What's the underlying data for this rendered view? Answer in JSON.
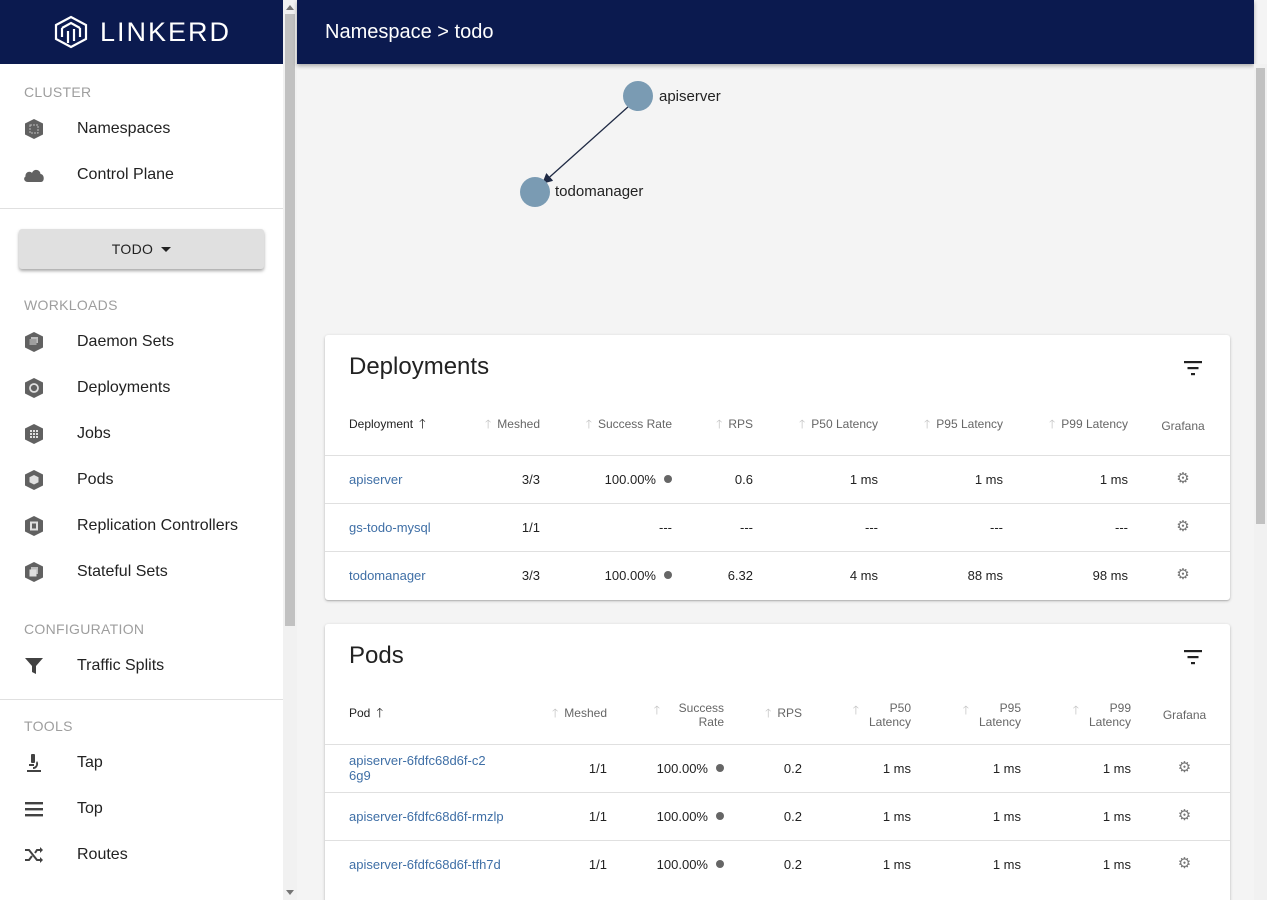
{
  "app": {
    "brand": "LINKERD"
  },
  "header": {
    "title": "Namespace > todo"
  },
  "sidebar": {
    "cluster_title": "CLUSTER",
    "cluster_items": [
      {
        "label": "Namespaces",
        "icon": "namespace-icon"
      },
      {
        "label": "Control Plane",
        "icon": "cloud-icon"
      }
    ],
    "namespace_select": "TODO",
    "workloads_title": "WORKLOADS",
    "workload_items": [
      {
        "label": "Daemon Sets",
        "icon": "daemonset-icon"
      },
      {
        "label": "Deployments",
        "icon": "deployment-icon"
      },
      {
        "label": "Jobs",
        "icon": "job-icon"
      },
      {
        "label": "Pods",
        "icon": "pod-icon"
      },
      {
        "label": "Replication Controllers",
        "icon": "replication-controller-icon"
      },
      {
        "label": "Stateful Sets",
        "icon": "statefulset-icon"
      }
    ],
    "configuration_title": "CONFIGURATION",
    "configuration_items": [
      {
        "label": "Traffic Splits",
        "icon": "filter-funnel-icon"
      }
    ],
    "tools_title": "TOOLS",
    "tools_items": [
      {
        "label": "Tap",
        "icon": "microscope-icon"
      },
      {
        "label": "Top",
        "icon": "list-icon"
      },
      {
        "label": "Routes",
        "icon": "shuffle-icon"
      }
    ]
  },
  "graph": {
    "nodes": [
      {
        "label": "apiserver"
      },
      {
        "label": "todomanager"
      }
    ],
    "node_color": "#7a9bb3"
  },
  "deployments": {
    "title": "Deployments",
    "columns": [
      "Deployment",
      "Meshed",
      "Success Rate",
      "RPS",
      "P50 Latency",
      "P95 Latency",
      "P99 Latency",
      "Grafana"
    ],
    "rows": [
      {
        "name": "apiserver",
        "meshed": "3/3",
        "success": "100.00%",
        "rps": "0.6",
        "p50": "1 ms",
        "p95": "1 ms",
        "p99": "1 ms",
        "has_dot": true
      },
      {
        "name": "gs-todo-mysql",
        "meshed": "1/1",
        "success": "---",
        "rps": "---",
        "p50": "---",
        "p95": "---",
        "p99": "---",
        "has_dot": false
      },
      {
        "name": "todomanager",
        "meshed": "3/3",
        "success": "100.00%",
        "rps": "6.32",
        "p50": "4 ms",
        "p95": "88 ms",
        "p99": "98 ms",
        "has_dot": true
      }
    ]
  },
  "pods": {
    "title": "Pods",
    "columns": [
      "Pod",
      "Meshed",
      "Success Rate",
      "RPS",
      "P50 Latency",
      "P95 Latency",
      "P99 Latency",
      "Grafana"
    ],
    "rows": [
      {
        "name": "apiserver-6fdfc68d6f-c26g9",
        "meshed": "1/1",
        "success": "100.00%",
        "rps": "0.2",
        "p50": "1 ms",
        "p95": "1 ms",
        "p99": "1 ms"
      },
      {
        "name": "apiserver-6fdfc68d6f-rmzlp",
        "meshed": "1/1",
        "success": "100.00%",
        "rps": "0.2",
        "p50": "1 ms",
        "p95": "1 ms",
        "p99": "1 ms"
      },
      {
        "name": "apiserver-6fdfc68d6f-tfh7d",
        "meshed": "1/1",
        "success": "100.00%",
        "rps": "0.2",
        "p50": "1 ms",
        "p95": "1 ms",
        "p99": "1 ms"
      }
    ]
  },
  "colors": {
    "header_bg": "#0b1a4f",
    "link": "#3f6fa6",
    "status_dot": "#666666"
  }
}
